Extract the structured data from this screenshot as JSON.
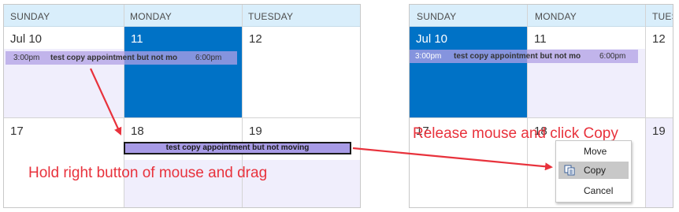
{
  "left_calendar": {
    "headers": [
      "SUNDAY",
      "MONDAY",
      "TUESDAY"
    ],
    "week1_dates": [
      "Jul 10",
      "11",
      "12"
    ],
    "week2_dates": [
      "17",
      "18",
      "19"
    ],
    "appointment": {
      "start": "3:00pm",
      "subject": "test copy appointment but not mo",
      "end": "6:00pm"
    },
    "dragged_appointment": "test copy appointment but not moving"
  },
  "right_calendar": {
    "headers": [
      "SUNDAY",
      "MONDAY",
      "TUES"
    ],
    "week1_dates": [
      "Jul 10",
      "11",
      "12"
    ],
    "week2_dates": [
      "17",
      "18",
      "19"
    ],
    "appointment": {
      "start": "3:00pm",
      "subject": "test copy appointment but not mo",
      "end": "6:00pm"
    }
  },
  "annotations": {
    "left": "Hold right button of mouse and drag",
    "right": "Release mouse and click Copy"
  },
  "context_menu": {
    "items": [
      {
        "label": "Move",
        "icon": ""
      },
      {
        "label": "Copy",
        "icon": "copy-icon",
        "highlighted": true
      },
      {
        "label": "Cancel",
        "icon": ""
      }
    ]
  },
  "colors": {
    "header_bg": "#d9eefb",
    "selected_day": "#0072c6",
    "appointment": "#b1a0e6",
    "annotation": "#e8323c"
  }
}
